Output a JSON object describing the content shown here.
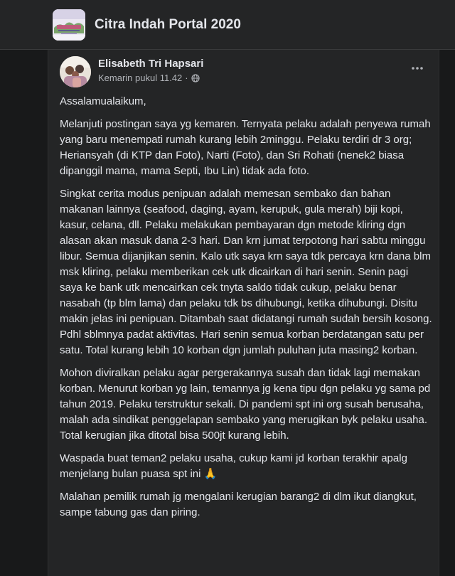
{
  "group": {
    "name": "Citra Indah Portal 2020"
  },
  "post": {
    "author": "Elisabeth Tri Hapsari",
    "timestamp": "Kemarin pukul 11.42",
    "separator": "·",
    "privacy_icon": "globe-icon",
    "more_icon": "more-horizontal-icon",
    "paragraphs": [
      "Assalamualaikum,",
      "Melanjuti postingan saya yg kemaren. Ternyata pelaku adalah penyewa rumah yang baru menempati rumah kurang lebih 2minggu. Pelaku terdiri dr 3 org; Heriansyah (di KTP dan Foto), Narti (Foto), dan Sri Rohati (nenek2 biasa dipanggil mama, mama Septi, Ibu Lin) tidak ada foto.",
      "Singkat cerita modus penipuan adalah memesan sembako dan bahan makanan lainnya (seafood, daging, ayam, kerupuk, gula merah) biji kopi, kasur, celana, dll. Pelaku melakukan pembayaran dgn metode kliring dgn alasan akan masuk dana 2-3 hari. Dan krn jumat terpotong hari sabtu minggu libur. Semua dijanjikan senin. Kalo utk saya krn saya tdk percaya krn dana blm msk kliring, pelaku memberikan cek utk dicairkan di hari senin. Senin pagi saya ke bank utk mencairkan cek tnyta saldo tidak cukup, pelaku benar nasabah (tp blm lama) dan pelaku tdk bs dihubungi, ketika dihubungi. Disitu makin jelas ini penipuan. Ditambah saat didatangi rumah sudah bersih kosong. Pdhl sblmnya padat aktivitas. Hari senin semua korban berdatangan satu per satu. Total kurang lebih 10 korban dgn jumlah puluhan juta masing2 korban.",
      "Mohon diviralkan pelaku agar pergerakannya susah dan tidak lagi memakan korban. Menurut korban yg lain, temannya jg kena tipu dgn pelaku yg sama pd tahun 2019. Pelaku terstruktur sekali. Di pandemi spt ini org susah berusaha, malah ada sindikat penggelapan sembako yang merugikan byk pelaku usaha. Total kerugian jika ditotal bisa 500jt kurang lebih.",
      "Waspada buat teman2 pelaku usaha, cukup kami jd korban terakhir apalg menjelang bulan puasa spt ini 🙏",
      "Malahan pemilik rumah jg mengalani kerugian barang2 di dlm ikut diangkut, sampe tabung gas dan piring."
    ]
  },
  "colors": {
    "page_bg": "#18191a",
    "card_bg": "#242526",
    "primary_text": "#e4e6eb",
    "secondary_text": "#b0b3b8"
  }
}
